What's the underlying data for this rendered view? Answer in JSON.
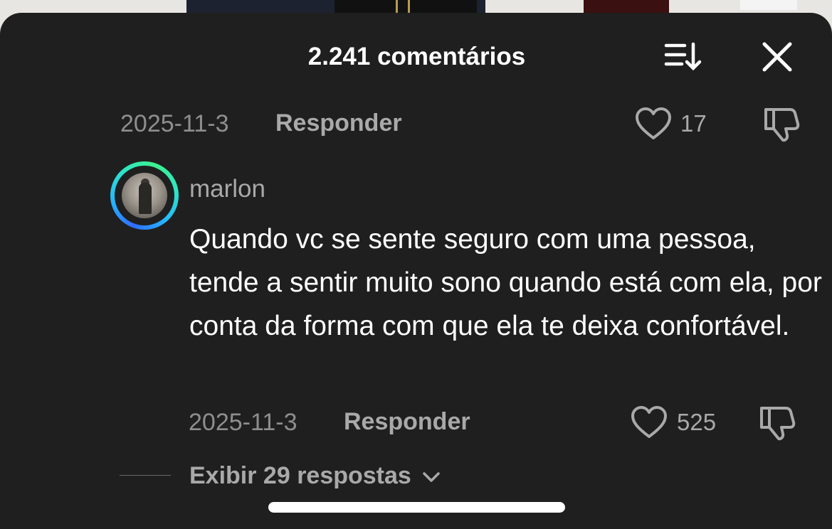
{
  "header": {
    "title": "2.241 comentários",
    "sort_icon": "sort-icon",
    "close_icon": "close-icon"
  },
  "previous_comment": {
    "date": "2025-11-3",
    "reply_label": "Responder",
    "like_count": "17"
  },
  "comment": {
    "username": "marlon",
    "text": "Quando vc se sente seguro com uma pessoa, tende a sentir muito sono quando está com ela, por conta da forma com que ela te deixa confortável.",
    "date": "2025-11-3",
    "reply_label": "Responder",
    "like_count": "525",
    "view_replies_label": "Exibir 29 respostas"
  },
  "colors": {
    "sheet_bg": "#1f1f1f",
    "primary_text": "#ffffff",
    "secondary_text": "#a9a9a9",
    "ring_gradient": [
      "#2f6bff",
      "#2ee6c4",
      "#3df08e"
    ]
  }
}
